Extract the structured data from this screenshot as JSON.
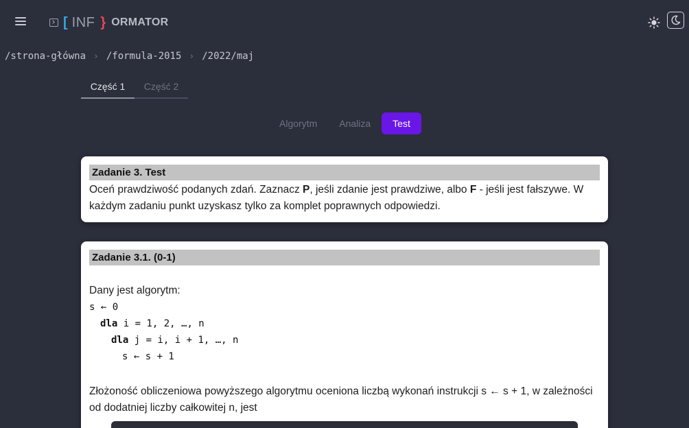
{
  "header": {
    "logo_bracket_open": "[",
    "logo_inf": "INF",
    "logo_bracket_close": "}",
    "logo_suffix": "ORMATOR",
    "accent_blue": "#33a8e6",
    "accent_red": "#e8445a"
  },
  "breadcrumb": [
    "/strona-główna",
    "/formula-2015",
    "/2022/maj"
  ],
  "part_tabs": [
    {
      "label": "Część 1",
      "active": true
    },
    {
      "label": "Część 2",
      "active": false
    }
  ],
  "mode_tabs": [
    {
      "label": "Algorytm",
      "active": false
    },
    {
      "label": "Analiza",
      "active": false
    },
    {
      "label": "Test",
      "active": true
    }
  ],
  "active_color": "#6a16e6",
  "task": {
    "title": "Zadanie 3. Test",
    "intro_a": "Oceń prawdziwość podanych zdań. Zaznacz ",
    "intro_p": "P",
    "intro_b": ", jeśli zdanie jest prawdziwe, albo ",
    "intro_f": "F",
    "intro_c": " - jeśli jest fałszywe. W każdym zadaniu punkt uzyskasz tylko za komplet poprawnych odpowiedzi."
  },
  "subtask": {
    "title": "Zadanie 3.1. (0-1)",
    "lead": "Dany jest algorytm:",
    "code": {
      "l1": "s ← 0",
      "l2_kw": "dla",
      "l2_rest": " i = 1, 2, …, n",
      "l3_kw": "dla",
      "l3_rest": " j = i, i + 1, …, n",
      "l4": "s ← s + 1"
    },
    "question": "Złożoność obliczeniowa powyższego algorytmu oceniona liczbą wykonań instrukcji s ← s + 1, w zależności od dodatniej liczby całkowitej n, jest"
  },
  "icons": {
    "menu": "hamburger-icon",
    "terminal": "terminal-icon",
    "light": "sun-icon",
    "dark": "moon-icon",
    "separator": "chevron-right-icon"
  }
}
